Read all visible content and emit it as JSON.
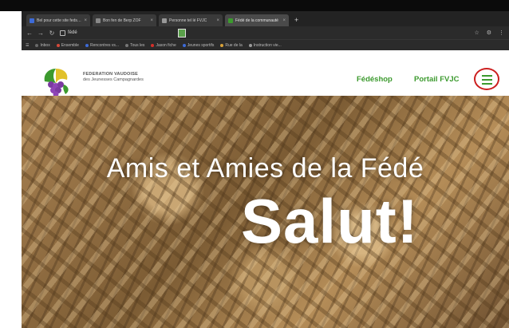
{
  "browser": {
    "tabs": [
      {
        "label": "Bel pour cette site fedsd 8",
        "fav_color": "#3d6bd8",
        "active": false
      },
      {
        "label": "Bon fen de Berp ZOF",
        "fav_color": "#888888",
        "active": false
      },
      {
        "label": "Personne tel lé FVJC",
        "fav_color": "#999999",
        "active": false
      },
      {
        "label": "Fédé de la communauté",
        "fav_color": "#3c9a2e",
        "active": true
      }
    ],
    "new_tab": "+",
    "url": "fédé",
    "bookmarks": [
      {
        "label": "Inbox",
        "color": "#6a6a6a"
      },
      {
        "label": "Ensemble",
        "color": "#d64a3a"
      },
      {
        "label": "Rencontres vs...",
        "color": "#3d6bd8"
      },
      {
        "label": "Tous les",
        "color": "#777777"
      },
      {
        "label": "Jason fiche",
        "color": "#d6302a"
      },
      {
        "label": "Jeunes sportifs",
        "color": "#3d6bd8"
      },
      {
        "label": "Rue de la",
        "color": "#d8a23a"
      },
      {
        "label": "Instruction vie...",
        "color": "#9a9a9a"
      }
    ]
  },
  "site": {
    "brand_line1": "FEDERATION VAUDOISE",
    "brand_line2": "des Jeunesses Campagnardes",
    "nav": {
      "fedeshop": "Fédéshop",
      "portail": "Portail FVJC"
    }
  },
  "hero": {
    "subtitle": "Amis et Amies de la Fédé",
    "title": "Salut!"
  }
}
